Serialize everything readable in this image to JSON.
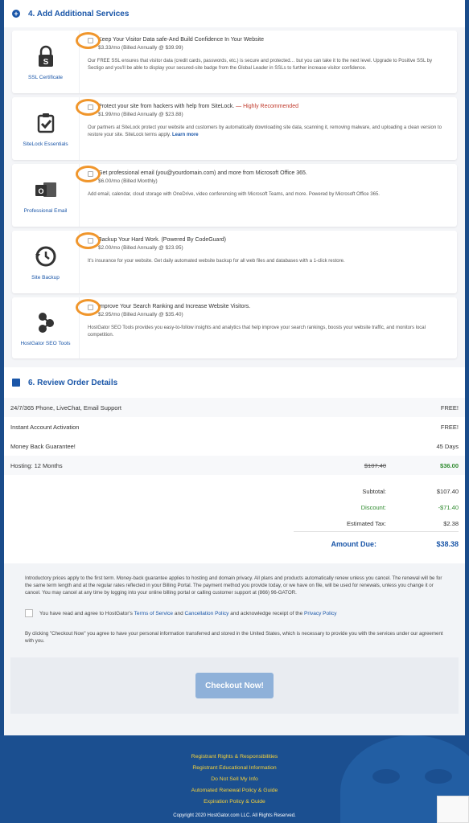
{
  "services_section": {
    "title": "4. Add Additional Services"
  },
  "services": [
    {
      "name": "SSL Certificate",
      "icon": "ssl-lock-icon",
      "title": "Keep Your Visitor Data safe-And Build Confidence In Your Website",
      "highlight": "",
      "price": "$3.33/mo (Billed Annually @ $39.99)",
      "desc": "Our FREE SSL ensures that visitor data (credit cards, passwords, etc.) is secure and protected… but you can take it to the next level. Upgrade to Positive SSL by Sectigo and you'll be able to display your secured-site badge from the Global Leader in SSLs to further increase visitor confidence.",
      "learn": ""
    },
    {
      "name": "SiteLock Essentials",
      "icon": "shield-check-icon",
      "title": "Protect your site from hackers with help from SiteLock.",
      "highlight": " — Highly Recommended",
      "price": "$1.99/mo (Billed Annually @ $23.88)",
      "desc": "Our partners at SiteLock protect your website and customers by automatically downloading site data, scanning it, removing malware, and uploading a clean version to restore your site. SiteLock terms apply.",
      "learn": "Learn more"
    },
    {
      "name": "Professional Email",
      "icon": "outlook-icon",
      "title": "Get professional email (you@yourdomain.com) and more from Microsoft Office 365.",
      "highlight": "",
      "price": "$6.00/mo (Billed Monthly)",
      "desc": "Add email, calendar, cloud storage with OneDrive, video conferencing with Microsoft Teams, and more. Powered by Microsoft Office 365.",
      "learn": ""
    },
    {
      "name": "Site Backup",
      "icon": "backup-clock-icon",
      "title": "Backup Your Hard Work. (Powered By CodeGuard)",
      "highlight": "",
      "price": "$2.00/mo (Billed Annually @ $23.95)",
      "desc": "It's insurance for your website. Get daily automated website backup for all web files and databases with a 1-click restore.",
      "learn": ""
    },
    {
      "name": "HostGator SEO Tools",
      "icon": "seo-tools-icon",
      "title": "Improve Your Search Ranking and Increase Website Visitors.",
      "highlight": "",
      "price": "$2.95/mo (Billed Annually @ $35.40)",
      "desc": "HostGator SEO Tools provides you easy-to-follow insights and analytics that help improve your search rankings, boosts your website traffic, and monitors local competition.",
      "learn": ""
    }
  ],
  "review_section": {
    "title": "6. Review Order Details"
  },
  "order_rows": [
    {
      "label": "24/7/365 Phone, LiveChat, Email Support",
      "value": "FREE!"
    },
    {
      "label": "Instant Account Activation",
      "value": "FREE!"
    },
    {
      "label": "Money Back Guarantee!",
      "value": "45 Days"
    }
  ],
  "hosting": {
    "label": "Hosting: 12 Months",
    "original": "$107.40",
    "price": "$36.00"
  },
  "totals": {
    "subtotal_label": "Subtotal:",
    "subtotal": "$107.40",
    "discount_label": "Discount:",
    "discount": "-$71.40",
    "tax_label": "Estimated Tax:",
    "tax": "$2.38",
    "amount_label": "Amount Due:",
    "amount": "$38.38"
  },
  "legal": {
    "intro": "Introductory prices apply to the first term. Money-back guarantee applies to hosting and domain privacy. All plans and products automatically renew unless you cancel. The renewal will be for the same term length and at the regular rates reflected in your Billing Portal. The payment method you provide today, or we have on file, will be used for renewals, unless you change it or cancel. You may cancel at any time by logging into your online billing portal or calling customer support at (866) 96-GATOR.",
    "agree_prefix": "You have read and agree to HostGator's",
    "tos": "Terms of Service",
    "and": "and",
    "cancel_policy": "Cancellation Policy",
    "ack": "and acknowledge receipt of the",
    "privacy": "Privacy Policy",
    "transfer": "By clicking \"Checkout Now\" you agree to have your personal information transferred and stored in the United States, which is necessary to provide you with the services under our agreement with you."
  },
  "checkout_label": "Checkout Now!",
  "footer": {
    "links": [
      "Registrant Rights & Responsibilities",
      "Registrant Educational Information",
      "Do Not Sell My Info",
      "Automated Renewal Policy & Guide",
      "Expiration Policy & Guide"
    ],
    "copyright": "Copyright 2020 HostGator.com LLC. All Rights Reserved."
  },
  "colors": {
    "brand_blue": "#1a56a8",
    "footer_blue": "#1b4f90",
    "link_yellow": "#f6d23a",
    "highlight_red": "#c0392b",
    "discount_green": "#2e8a2e",
    "annotation_orange": "#f0962c"
  }
}
